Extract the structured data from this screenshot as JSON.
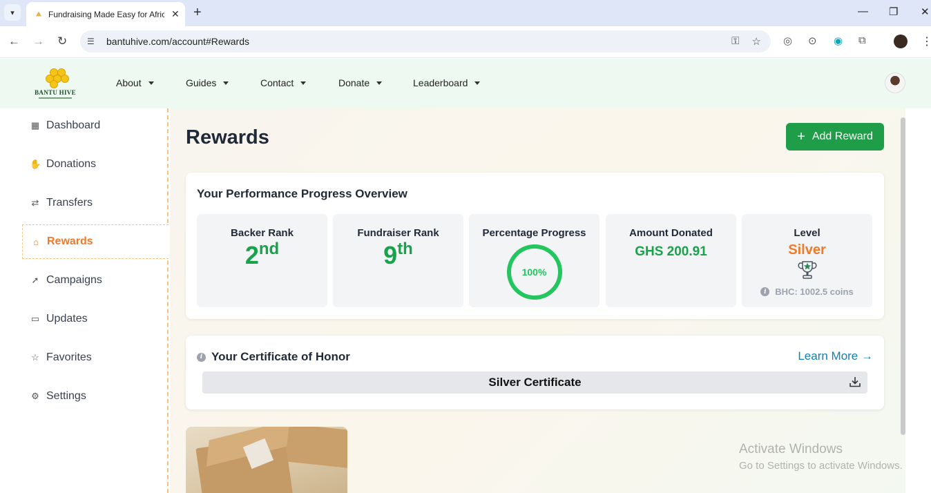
{
  "browser": {
    "tab_title": "Fundraising Made Easy for Afric",
    "url": "bantuhive.com/account#Rewards",
    "new_tab": "+",
    "tab_close": "✕",
    "win_min": "—",
    "win_max": "❐",
    "win_close": "✕"
  },
  "site": {
    "logo_text": "BANTU HIVE",
    "nav": [
      "About",
      "Guides",
      "Contact",
      "Donate",
      "Leaderboard"
    ]
  },
  "sidebar": {
    "items": [
      {
        "label": "Dashboard",
        "icon": "grid-icon"
      },
      {
        "label": "Donations",
        "icon": "hand-icon"
      },
      {
        "label": "Transfers",
        "icon": "transfer-icon"
      },
      {
        "label": "Rewards",
        "icon": "gift-icon"
      },
      {
        "label": "Campaigns",
        "icon": "rocket-icon"
      },
      {
        "label": "Updates",
        "icon": "chat-icon"
      },
      {
        "label": "Favorites",
        "icon": "star-icon"
      },
      {
        "label": "Settings",
        "icon": "gear-icon"
      }
    ],
    "active": "Rewards"
  },
  "main": {
    "title": "Rewards",
    "add_button": "Add Reward",
    "performance": {
      "title": "Your Performance Progress Overview",
      "backer_label": "Backer Rank",
      "backer_value": "2",
      "backer_suffix": "nd",
      "fundraiser_label": "Fundraiser Rank",
      "fundraiser_value": "9",
      "fundraiser_suffix": "th",
      "progress_label": "Percentage Progress",
      "progress_value": "100%",
      "amount_label": "Amount Donated",
      "amount_value": "GHS 200.91",
      "level_label": "Level",
      "level_value": "Silver",
      "coins": "BHC: 1002.5 coins"
    },
    "certificate": {
      "title": "Your Certificate of Honor",
      "learn_more": "Learn More →",
      "name": "Silver Certificate"
    }
  },
  "os": {
    "watermark_title": "Activate Windows",
    "watermark_sub": "Go to Settings to activate Windows."
  },
  "colors": {
    "accent_green": "#1f9d48",
    "active_orange": "#f07a2a",
    "link_blue": "#0e7fb5"
  }
}
